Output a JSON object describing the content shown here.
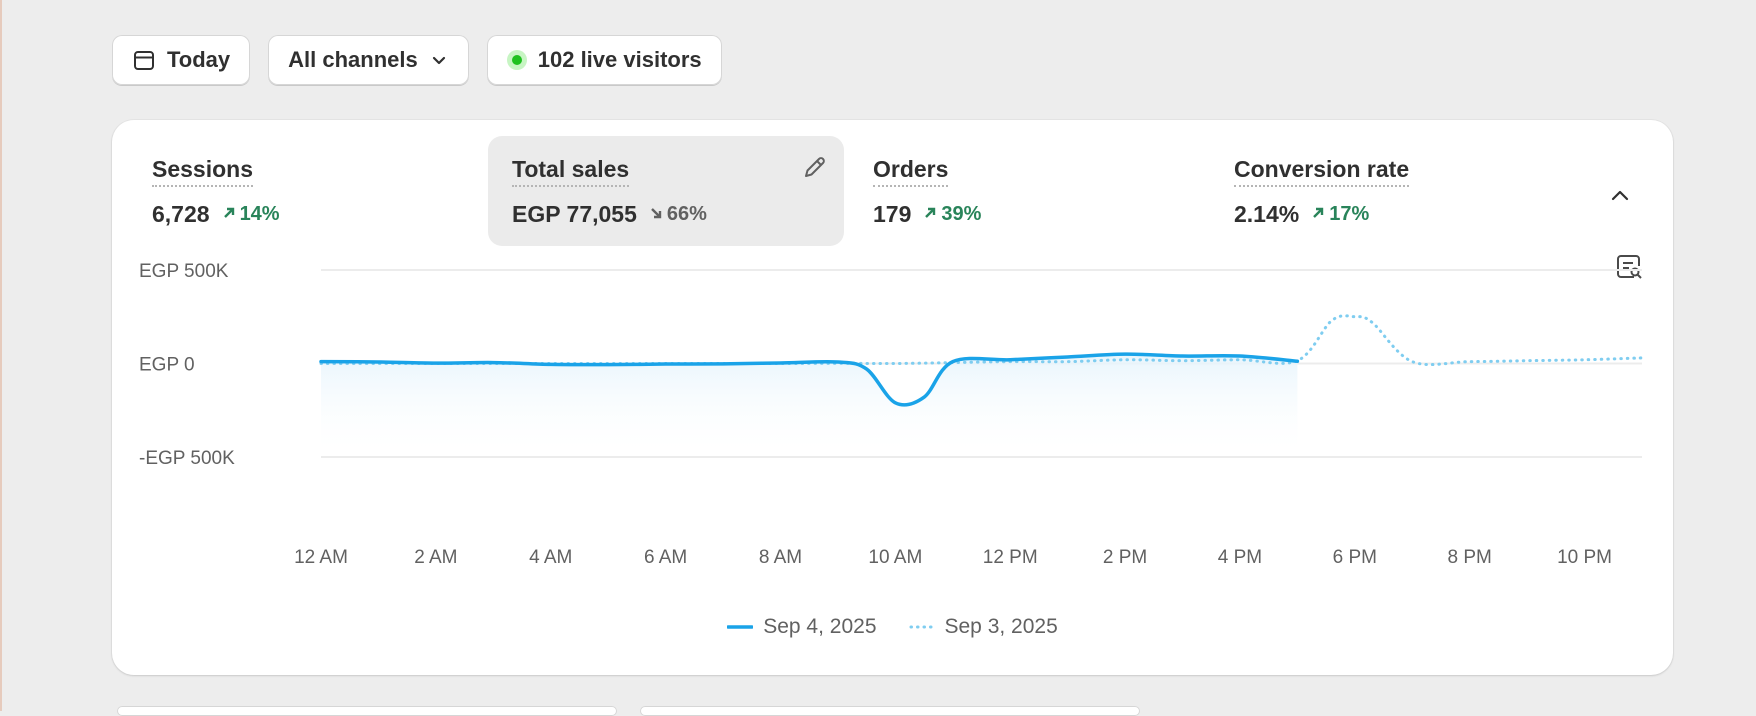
{
  "filters": {
    "date_label": "Today",
    "channel_label": "All channels",
    "live_label": "102 live visitors"
  },
  "metrics": [
    {
      "title": "Sessions",
      "value": "6,728",
      "change": "14%",
      "direction": "up",
      "active": false
    },
    {
      "title": "Total sales",
      "value": "EGP 77,055",
      "change": "66%",
      "direction": "down",
      "active": true
    },
    {
      "title": "Orders",
      "value": "179",
      "change": "39%",
      "direction": "up",
      "active": false
    },
    {
      "title": "Conversion rate",
      "value": "2.14%",
      "change": "17%",
      "direction": "up",
      "active": false
    }
  ],
  "colors": {
    "primary_series": "#1aa3e8",
    "comparison_series": "#7fcdf0",
    "up": "#29845a",
    "down": "#616161",
    "live": "#1fc11f"
  },
  "icons": [
    "calendar-icon",
    "chevron-down-icon",
    "live-dot-icon",
    "pencil-icon",
    "chevron-up-icon",
    "chart-insight-icon",
    "arrow-up-right-icon",
    "arrow-down-right-icon"
  ],
  "chart_data": {
    "type": "line",
    "ylabel_ticks": [
      "EGP 500K",
      "EGP 0",
      "-EGP 500K"
    ],
    "yticks": [
      500000,
      0,
      -500000
    ],
    "ylim": [
      -500000,
      500000
    ],
    "x_tick_labels": [
      "12 AM",
      "2 AM",
      "4 AM",
      "6 AM",
      "8 AM",
      "10 AM",
      "12 PM",
      "2 PM",
      "4 PM",
      "6 PM",
      "8 PM",
      "10 PM"
    ],
    "x_tick_hours": [
      0,
      2,
      4,
      6,
      8,
      10,
      12,
      14,
      16,
      18,
      20,
      22
    ],
    "xlim": [
      0,
      23
    ],
    "grid": true,
    "legend": "bottom-center",
    "series": [
      {
        "name": "Sep 4, 2025",
        "style": "solid",
        "x": [
          0,
          1,
          2,
          3,
          4,
          5,
          6,
          7,
          8,
          9,
          9.5,
          10,
          10.5,
          11,
          12,
          13,
          14,
          15,
          16,
          17
        ],
        "values": [
          10000,
          8000,
          2000,
          5000,
          -5000,
          -6000,
          -3000,
          -2000,
          3000,
          8000,
          -30000,
          -210000,
          -180000,
          10000,
          20000,
          35000,
          50000,
          40000,
          40000,
          12000
        ]
      },
      {
        "name": "Sep 3, 2025",
        "style": "dotted",
        "x": [
          0,
          2,
          4,
          6,
          8,
          9,
          10,
          11,
          12,
          13,
          14,
          15,
          16,
          17,
          17.6,
          18,
          18.3,
          19,
          20,
          21,
          22,
          23
        ],
        "values": [
          0,
          0,
          0,
          0,
          0,
          1000,
          0,
          5000,
          10000,
          10000,
          20000,
          15000,
          20000,
          15000,
          230000,
          250000,
          220000,
          10000,
          10000,
          15000,
          20000,
          30000
        ]
      }
    ]
  }
}
